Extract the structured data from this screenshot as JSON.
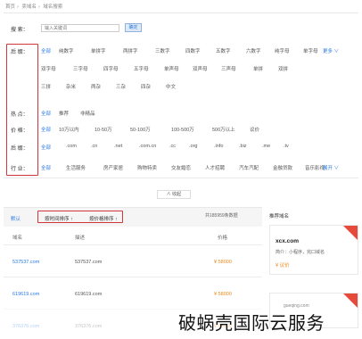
{
  "breadcrumb": [
    "首页",
    "卖域名",
    "域名搜索"
  ],
  "search": {
    "label": "搜  索：",
    "placeholder": "输入关键词",
    "button": "确定"
  },
  "filters": {
    "suffix_label": "后  缀：",
    "suffix_options_row1": [
      "全部",
      "纯数字",
      "单拼字",
      "两拼字",
      "三数字",
      "四数字",
      "五数字",
      "六数字",
      "纯字母",
      "单字母"
    ],
    "suffix_options_row2": [
      "双字母",
      "三字母",
      "四字母",
      "五字母",
      "单声母",
      "双声母",
      "三声母",
      "单拼",
      "双拼"
    ],
    "suffix_options_row3": [
      "三拼",
      "杂米",
      "两杂",
      "三杂",
      "四杂",
      "中文"
    ],
    "more_label": "更多 ∨",
    "hot_label": "热  点：",
    "hot_options": [
      "全部",
      "推荐",
      "非精品"
    ],
    "price_label": "价  格：",
    "price_options": [
      "全部",
      "10万以内",
      "10-50万",
      "50-100万",
      "100-500万",
      "500万以上",
      "议价"
    ],
    "tld_label": "后  缀：",
    "tld_options": [
      "全部",
      ".com",
      ".cn",
      ".net",
      ".com.cn",
      ".cc",
      ".org",
      ".info",
      ".biz",
      ".me",
      ".tv"
    ],
    "industry_label": "行  业：",
    "industry_options": [
      "全部",
      "生活服务",
      "房产家居",
      "购物特卖",
      "交友婚恋",
      "人才招聘",
      "汽车汽配",
      "金融贷款",
      "音乐影视"
    ],
    "industry_more": "展开 ∨"
  },
  "collapse_label": "∧ 收起",
  "results": {
    "sort_all": "默认",
    "sort_time": "按时间排序 ↑",
    "sort_price": "按价格排序 ↑",
    "count_text": "共185959条数据",
    "col_domain": "域名",
    "col_desc": "描述",
    "col_price": "价格",
    "rows": [
      {
        "domain": "537537.com",
        "desc": "537537.com",
        "price": "¥ 58000"
      },
      {
        "domain": "619619.com",
        "desc": "619619.com",
        "price": "¥ 58000"
      },
      {
        "domain": "376376.com",
        "desc": "376376.com",
        "price": "¥ 58000"
      }
    ]
  },
  "side": {
    "title": "推荐域名",
    "card1_domain": "xcx.com",
    "card1_desc": "简介：小程序，完口域名",
    "card1_price": "¥ 议价",
    "card2_domain": "gueqing.com"
  },
  "watermark": {
    "text": "破蜗壳国际云服务"
  },
  "colors": {
    "accent": "#2a7ae2",
    "highlight_box": "#d0363a",
    "price": "#e88a1a"
  }
}
